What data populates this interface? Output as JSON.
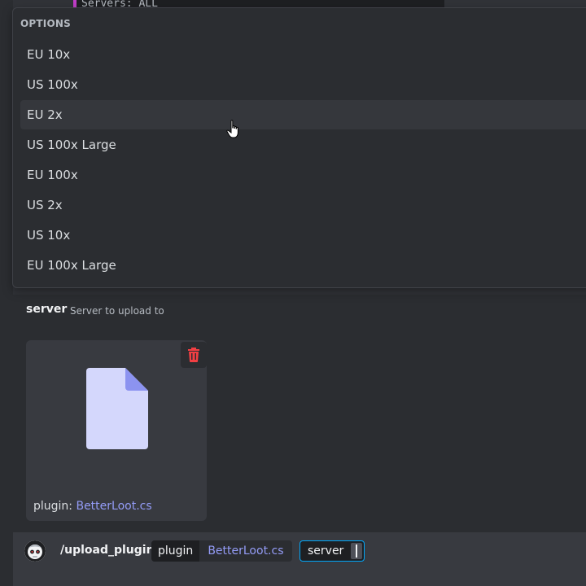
{
  "background": {
    "code_text": "Servers: ALL"
  },
  "options": {
    "header": "OPTIONS",
    "items": [
      {
        "label": "EU 10x"
      },
      {
        "label": "US 100x"
      },
      {
        "label": "EU 2x"
      },
      {
        "label": "US 100x Large"
      },
      {
        "label": "EU 100x"
      },
      {
        "label": "US 2x"
      },
      {
        "label": "US 10x"
      },
      {
        "label": "EU 100x Large"
      }
    ],
    "hovered_index": 2
  },
  "server_option": {
    "name": "server",
    "description": "Server to upload to"
  },
  "attachment": {
    "label_prefix": "plugin: ",
    "filename": "BetterLoot.cs",
    "trash_icon": "trash-icon",
    "file_icon": "file-icon"
  },
  "chatbar": {
    "command": "/upload_plugin",
    "params": {
      "plugin_name": "plugin",
      "plugin_value": "BetterLoot.cs",
      "server_name": "server"
    }
  },
  "colors": {
    "accent": "#949cf7",
    "danger": "#f23f43",
    "focus": "#00a8fc",
    "code_border": "#c23ec9"
  }
}
